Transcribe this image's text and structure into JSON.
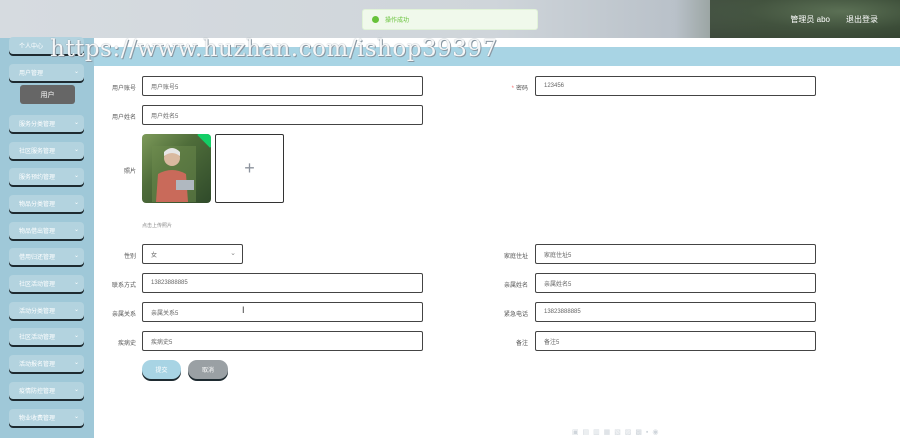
{
  "header": {
    "user_label": "管理员 abo",
    "logout_label": "退出登录"
  },
  "toast": {
    "message": "操作成功"
  },
  "watermark": "https://www.huzhan.com/ishop39397",
  "sidebar": {
    "items": [
      {
        "label": "个人中心"
      },
      {
        "label": "用户管理"
      },
      {
        "label": "服务分类管理"
      },
      {
        "label": "社区服务管理"
      },
      {
        "label": "服务预约管理"
      },
      {
        "label": "物品分类管理"
      },
      {
        "label": "物品借出管理"
      },
      {
        "label": "借用归还管理"
      },
      {
        "label": "社区活动管理"
      },
      {
        "label": "活动分类管理"
      },
      {
        "label": "社区活动管理"
      },
      {
        "label": "活动报名管理"
      },
      {
        "label": "疫情防控管理"
      },
      {
        "label": "物业收费管理"
      }
    ],
    "active_sub": "用户"
  },
  "form": {
    "account": {
      "label": "用户账号",
      "value": "用户账号5"
    },
    "password": {
      "label": "密码",
      "value": "123456"
    },
    "name": {
      "label": "用户姓名",
      "value": "用户姓名5"
    },
    "photo": {
      "label": "照片",
      "hint": "点击上传照片"
    },
    "gender": {
      "label": "性别",
      "value": "女"
    },
    "address": {
      "label": "家庭住址",
      "value": "家庭住址5"
    },
    "phone": {
      "label": "联系方式",
      "value": "13823888885"
    },
    "relative_name": {
      "label": "亲属姓名",
      "value": "亲属姓名5"
    },
    "relation": {
      "label": "亲属关系",
      "value": "亲属关系5"
    },
    "emergency_phone": {
      "label": "紧急电话",
      "value": "13823888885"
    },
    "medical": {
      "label": "疾病史",
      "value": "疾病史5"
    },
    "remark": {
      "label": "备注",
      "value": "备注5"
    },
    "submit_label": "提交",
    "cancel_label": "取消"
  },
  "colors": {
    "sidebar_bg": "#9fc8d8",
    "accent": "#a8d4e4",
    "success": "#67c23a"
  }
}
